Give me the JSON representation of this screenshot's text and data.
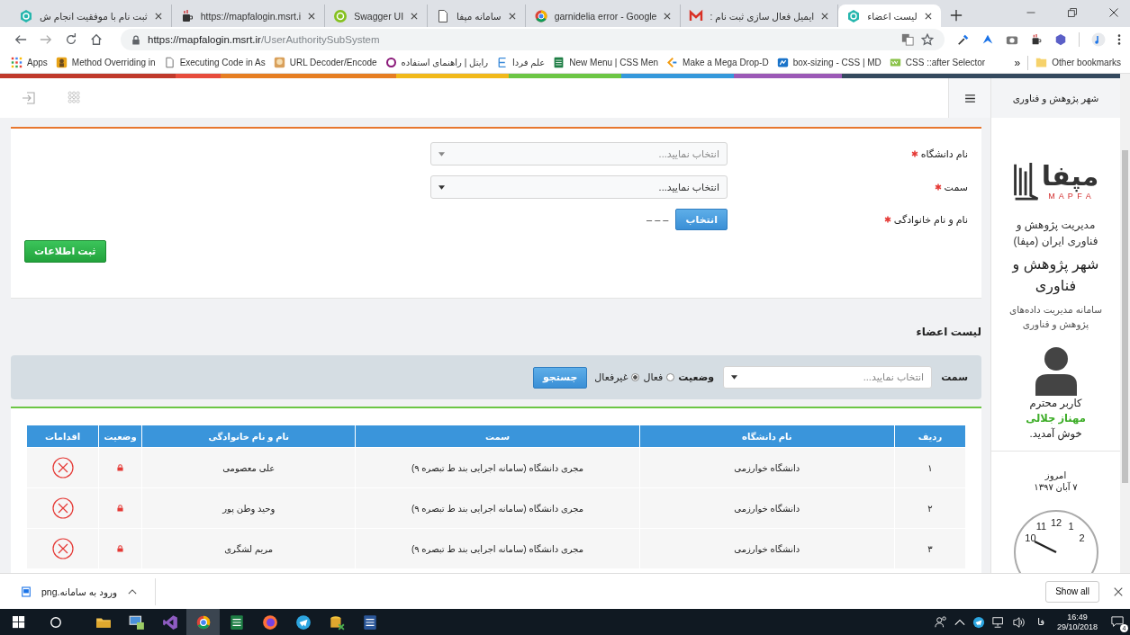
{
  "browser": {
    "tabs": [
      {
        "title": "لیست اعضاء",
        "kind": "hexagon",
        "selected": true
      },
      {
        "title": "ایمیل فعال سازی ثبت نام :",
        "kind": "mail",
        "selected": false
      },
      {
        "title": "garnidelia error - Google",
        "kind": "ring",
        "selected": false
      },
      {
        "title": "سامانه مپفا",
        "kind": "page",
        "selected": false
      },
      {
        "title": "Swagger UI",
        "kind": "green-circle",
        "selected": false
      },
      {
        "title": "https://mapfalogin.msrt.i",
        "kind": "cup",
        "selected": false
      },
      {
        "title": "ثبت نام با موفقیت انجام ش",
        "kind": "hexagon",
        "selected": false
      }
    ],
    "address": {
      "host": "https://mapfalogin.msrt.ir",
      "path": "/UserAuthoritySubSystem"
    },
    "bookmarks": [
      {
        "label": "CSS ::after Selector",
        "kind": "badge"
      },
      {
        "label": "box-sizing - CSS | MD",
        "kind": "map"
      },
      {
        "label": "Make a Mega Drop-D",
        "kind": "chevron"
      },
      {
        "label": "New Menu | CSS Men",
        "kind": "sheet"
      },
      {
        "label": "علم فردا",
        "kind": "bars"
      },
      {
        "label": "رایتل | راهنمای استفاده",
        "kind": "purple-ring"
      },
      {
        "label": "URL Decoder/Encode",
        "kind": "picture"
      },
      {
        "label": "Executing Code in As",
        "kind": "page"
      },
      {
        "label": "Method Overriding in",
        "kind": "figure"
      },
      {
        "label": "Apps",
        "kind": "apps"
      }
    ],
    "more_bookmarks": "»",
    "other_bookmarks": "Other bookmarks"
  },
  "page": {
    "header": {
      "site_title": "شهر پژوهش و فناوری"
    },
    "form": {
      "fields": [
        {
          "label": "نام دانشگاه",
          "required": true,
          "kind": "select",
          "placeholder": "انتخاب نمایید..."
        },
        {
          "label": "سمت",
          "required": true,
          "kind": "select",
          "value": "انتخاب نمایید..."
        },
        {
          "label": "نام و نام خانوادگی",
          "required": true,
          "kind": "picker",
          "button": "انتخاب",
          "value": "– – –"
        }
      ],
      "submit": "ثبت اطلاعات"
    },
    "members": {
      "title": "لیست اعضاء",
      "filter": {
        "label": "سمت",
        "placeholder": "انتخاب نمایید...",
        "status_label": "وضعیت",
        "options": [
          {
            "label": "فعال",
            "selected": false
          },
          {
            "label": "غیرفعال",
            "selected": true
          }
        ],
        "search": "جستجو"
      },
      "columns": [
        "ردیف",
        "نام دانشگاه",
        "سمت",
        "نام و نام خانوادگی",
        "وضعیت",
        "اقدامات"
      ],
      "rows": [
        {
          "index": "۱",
          "university": "دانشگاه خوارزمی",
          "role": "مجری دانشگاه (سامانه اجرایی بند ط تبصره ۹)",
          "name": "علی معصومی",
          "locked": true
        },
        {
          "index": "۲",
          "university": "دانشگاه خوارزمی",
          "role": "مجری دانشگاه (سامانه اجرایی بند ط تبصره ۹)",
          "name": "وحید وطن پور",
          "locked": true
        },
        {
          "index": "۳",
          "university": "دانشگاه خوارزمی",
          "role": "مجری دانشگاه (سامانه اجرایی بند ط تبصره ۹)",
          "name": "مریم لشگری",
          "locked": true
        }
      ]
    },
    "sidebar": {
      "logo_word": "مپفا",
      "logo_caption": "M A P F A",
      "org": "مدیریت پژوهش و فناوری ایران (مپفا)",
      "city": "شهر پژوهش و فناوری",
      "system": "سامانه مدیریت داده‌های پژوهش و فناوری",
      "greeting": "کاربر محترم",
      "user": "مهناز جلالی",
      "welcome": "خوش آمدید.",
      "today_label": "امروز",
      "date": "۷ آبان ۱۳۹۷",
      "clock_numerals": [
        "11",
        "12",
        "1",
        "10",
        "2"
      ]
    }
  },
  "downloads": {
    "file": "ورود به سامانه.png",
    "show_all": "Show all"
  },
  "taskbar": {
    "apps": [
      {
        "kind": "folder",
        "active": false
      },
      {
        "kind": "monitor",
        "active": false
      },
      {
        "kind": "ribbon",
        "active": false
      },
      {
        "kind": "ring",
        "active": true
      },
      {
        "kind": "sheet",
        "active": false
      },
      {
        "kind": "orange-circle",
        "active": false
      },
      {
        "kind": "plane",
        "active": false
      },
      {
        "kind": "database",
        "active": false
      },
      {
        "kind": "word",
        "active": false
      }
    ],
    "language": "فا",
    "time": "16:49",
    "date": "29/10/2018",
    "notifications": "4"
  }
}
